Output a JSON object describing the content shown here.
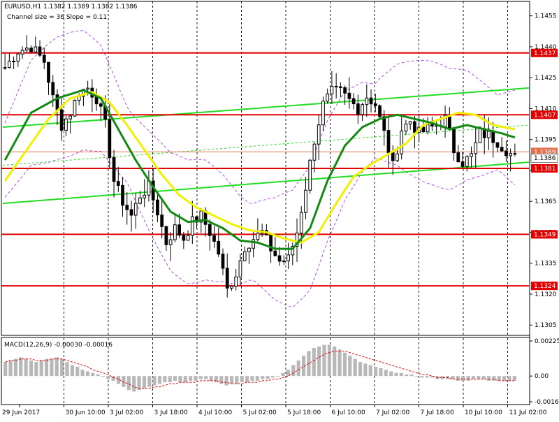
{
  "header": {
    "symbol_line": "EURUSD,H1  1.1382 1.1389 1.1382 1.1386",
    "channel_line": "Channel size = 36 Slope = 0.11"
  },
  "macd_header": "MACD(12,26,9) -0.00030 -0.00016",
  "colors": {
    "candle": "#000000",
    "level": "#e00000",
    "level_label_bg": "#e00000",
    "ma_green": "#138a13",
    "ma_yellow": "#f0f000",
    "channel": "#22dd22",
    "envelope": "#b050e0",
    "grid": "#000000",
    "macd_hist": "#b8b8b8",
    "macd_signal": "#e00000"
  },
  "chart_data": [
    {
      "type": "candlestick",
      "title": "EURUSD,H1",
      "ylim": [
        1.13,
        1.1462
      ],
      "y_ticks": [
        "1.1455",
        "1.1440",
        "1.1425",
        "1.1410",
        "1.1395",
        "1.1380",
        "1.1365",
        "1.1350",
        "1.1335",
        "1.1320",
        "1.1305"
      ],
      "x_labels": [
        "29 Jun 2017",
        "30 Jun 10:00",
        "3 Jul 02:00",
        "3 Jul 18:00",
        "4 Jul 10:00",
        "5 Jul 02:00",
        "5 Jul 18:00",
        "6 Jul 10:00",
        "7 Jul 02:00",
        "7 Jul 18:00",
        "10 Jul 10:00",
        "11 Jul 02:00"
      ],
      "levels": [
        {
          "label": "1.1437",
          "value": 1.1437
        },
        {
          "label": "1.1407",
          "value": 1.1407
        },
        {
          "label": "1.1381",
          "value": 1.1381
        },
        {
          "label": "1.1349",
          "value": 1.1349
        },
        {
          "label": "1.1324",
          "value": 1.1324
        }
      ],
      "current_price": {
        "label": "1.1386",
        "value": 1.1386
      },
      "bid_level": {
        "label": "1.1389",
        "value": 1.1389
      },
      "grid": "vertical-dotted",
      "price_path": [
        [
          0,
          1.143
        ],
        [
          3,
          1.1438
        ],
        [
          6,
          1.144
        ],
        [
          9,
          1.1433
        ],
        [
          11,
          1.1415
        ],
        [
          13,
          1.1402
        ],
        [
          15,
          1.1408
        ],
        [
          17,
          1.1418
        ],
        [
          19,
          1.142
        ],
        [
          21,
          1.1415
        ],
        [
          23,
          1.1402
        ],
        [
          25,
          1.1375
        ],
        [
          27,
          1.1365
        ],
        [
          29,
          1.1358
        ],
        [
          31,
          1.1368
        ],
        [
          33,
          1.1372
        ],
        [
          35,
          1.136
        ],
        [
          37,
          1.1345
        ],
        [
          39,
          1.1352
        ],
        [
          41,
          1.1347
        ],
        [
          43,
          1.1355
        ],
        [
          45,
          1.1358
        ],
        [
          47,
          1.135
        ],
        [
          49,
          1.134
        ],
        [
          51,
          1.1322
        ],
        [
          53,
          1.133
        ],
        [
          55,
          1.1343
        ],
        [
          57,
          1.1347
        ],
        [
          59,
          1.135
        ],
        [
          61,
          1.1342
        ],
        [
          63,
          1.1336
        ],
        [
          65,
          1.1337
        ],
        [
          67,
          1.135
        ],
        [
          69,
          1.1372
        ],
        [
          71,
          1.1395
        ],
        [
          73,
          1.1412
        ],
        [
          75,
          1.1418
        ],
        [
          77,
          1.1418
        ],
        [
          79,
          1.1414
        ],
        [
          81,
          1.141
        ],
        [
          83,
          1.1416
        ],
        [
          85,
          1.1412
        ],
        [
          87,
          1.1398
        ],
        [
          89,
          1.1382
        ],
        [
          91,
          1.14
        ],
        [
          93,
          1.1404
        ],
        [
          95,
          1.1398
        ],
        [
          97,
          1.14
        ],
        [
          99,
          1.1402
        ],
        [
          101,
          1.1405
        ],
        [
          103,
          1.139
        ],
        [
          105,
          1.1384
        ],
        [
          107,
          1.1387
        ],
        [
          109,
          1.1398
        ],
        [
          111,
          1.1397
        ],
        [
          113,
          1.1394
        ],
        [
          115,
          1.139
        ],
        [
          117,
          1.1386
        ]
      ],
      "ma_green": [
        [
          0,
          1.1385
        ],
        [
          6,
          1.1408
        ],
        [
          12,
          1.1415
        ],
        [
          18,
          1.1419
        ],
        [
          22,
          1.1415
        ],
        [
          26,
          1.14
        ],
        [
          30,
          1.1385
        ],
        [
          34,
          1.1372
        ],
        [
          38,
          1.136
        ],
        [
          42,
          1.1355
        ],
        [
          46,
          1.1356
        ],
        [
          50,
          1.1352
        ],
        [
          54,
          1.1346
        ],
        [
          58,
          1.1345
        ],
        [
          62,
          1.1342
        ],
        [
          66,
          1.1342
        ],
        [
          70,
          1.1352
        ],
        [
          74,
          1.1375
        ],
        [
          78,
          1.1392
        ],
        [
          82,
          1.1401
        ],
        [
          86,
          1.1405
        ],
        [
          90,
          1.1407
        ],
        [
          94,
          1.1405
        ],
        [
          98,
          1.1403
        ],
        [
          102,
          1.14
        ],
        [
          106,
          1.1402
        ],
        [
          110,
          1.14
        ],
        [
          114,
          1.1398
        ],
        [
          117,
          1.1396
        ]
      ],
      "ma_yellow": [
        [
          0,
          1.1375
        ],
        [
          5,
          1.139
        ],
        [
          10,
          1.1405
        ],
        [
          15,
          1.1415
        ],
        [
          20,
          1.1418
        ],
        [
          24,
          1.1413
        ],
        [
          28,
          1.1402
        ],
        [
          32,
          1.139
        ],
        [
          36,
          1.1378
        ],
        [
          40,
          1.1368
        ],
        [
          44,
          1.1362
        ],
        [
          48,
          1.1358
        ],
        [
          52,
          1.1354
        ],
        [
          56,
          1.1351
        ],
        [
          60,
          1.135
        ],
        [
          64,
          1.1347
        ],
        [
          68,
          1.1345
        ],
        [
          72,
          1.135
        ],
        [
          76,
          1.1364
        ],
        [
          80,
          1.1377
        ],
        [
          84,
          1.1383
        ],
        [
          88,
          1.1388
        ],
        [
          92,
          1.1393
        ],
        [
          96,
          1.1402
        ],
        [
          100,
          1.1405
        ],
        [
          104,
          1.1408
        ],
        [
          108,
          1.1407
        ],
        [
          112,
          1.1402
        ],
        [
          117,
          1.14
        ]
      ],
      "channel_upper": [
        [
          0,
          1.1401
        ],
        [
          117,
          1.142
        ]
      ],
      "channel_lower": [
        [
          0,
          1.1364
        ],
        [
          117,
          1.1384
        ]
      ]
    },
    {
      "type": "bar",
      "title": "MACD(12,26,9)",
      "ylim": [
        -0.00018,
        0.00026
      ],
      "y_ticks": [
        "0.00225",
        "0.00",
        "-0.00165"
      ],
      "histogram": [
        0.0009,
        0.001,
        0.0011,
        0.0012,
        0.0011,
        0.001,
        0.0009,
        0.001,
        0.0011,
        0.0011,
        0.0012,
        0.0011,
        0.0009,
        0.0007,
        0.0006,
        0.0004,
        0.0003,
        0.0002,
        0.0001,
        0.0,
        -0.0002,
        -0.0003,
        -0.0005,
        -0.0007,
        -0.0009,
        -0.001,
        -0.0009,
        -0.0008,
        -0.0007,
        -0.0006,
        -0.0005,
        -0.0004,
        -0.0004,
        -0.0003,
        -0.0004,
        -0.0004,
        -0.0003,
        -0.0003,
        -0.0002,
        -0.0002,
        -0.0003,
        -0.0004,
        -0.0005,
        -0.0006,
        -0.0005,
        -0.0005,
        -0.0004,
        -0.0004,
        -0.0003,
        -0.0003,
        -0.0002,
        -0.0002,
        -0.0001,
        0.0,
        0.0002,
        0.0004,
        0.0007,
        0.001,
        0.0013,
        0.0016,
        0.0018,
        0.0019,
        0.002,
        0.002,
        0.0019,
        0.0017,
        0.0015,
        0.0013,
        0.0011,
        0.0009,
        0.0008,
        0.0007,
        0.0006,
        0.0005,
        0.0004,
        0.0003,
        0.0002,
        0.0002,
        0.0001,
        0.0001,
        0.0,
        -0.0001,
        -0.0001,
        -0.0001,
        -0.0002,
        -0.0002,
        -0.0002,
        -0.0002,
        -0.0003,
        -0.0003,
        -0.0003,
        -0.0002,
        -0.0002,
        -0.0002,
        -0.0003,
        -0.0003,
        -0.0003,
        -0.0003,
        -0.0003,
        -0.0003
      ],
      "signal": [
        0.0009,
        0.001,
        0.001,
        0.0011,
        0.0011,
        0.0011,
        0.001,
        0.001,
        0.001,
        0.0011,
        0.0011,
        0.0011,
        0.001,
        0.0009,
        0.0008,
        0.0007,
        0.0006,
        0.0004,
        0.0003,
        0.0002,
        0.0001,
        -0.0001,
        -0.0002,
        -0.0004,
        -0.0005,
        -0.0007,
        -0.0008,
        -0.0008,
        -0.0008,
        -0.0007,
        -0.0007,
        -0.0006,
        -0.0005,
        -0.0005,
        -0.0004,
        -0.0004,
        -0.0004,
        -0.0004,
        -0.0003,
        -0.0003,
        -0.0003,
        -0.0003,
        -0.0004,
        -0.0004,
        -0.0005,
        -0.0005,
        -0.0005,
        -0.0004,
        -0.0004,
        -0.0004,
        -0.0003,
        -0.0003,
        -0.0002,
        -0.0002,
        -0.0001,
        0.0,
        0.0002,
        0.0004,
        0.0006,
        0.0008,
        0.001,
        0.0012,
        0.0014,
        0.0015,
        0.0016,
        0.0016,
        0.0016,
        0.0015,
        0.0014,
        0.0013,
        0.0012,
        0.0011,
        0.001,
        0.0009,
        0.0008,
        0.0007,
        0.0006,
        0.0005,
        0.0004,
        0.0003,
        0.0002,
        0.0001,
        0.0001,
        0.0,
        -0.0001,
        -0.0001,
        -0.0001,
        -0.0002,
        -0.0002,
        -0.0002,
        -0.0002,
        -0.0002,
        -0.0002,
        -0.0002,
        -0.0002,
        -0.0002,
        -0.0003,
        -0.0003,
        -0.0003,
        -0.0003
      ]
    }
  ]
}
